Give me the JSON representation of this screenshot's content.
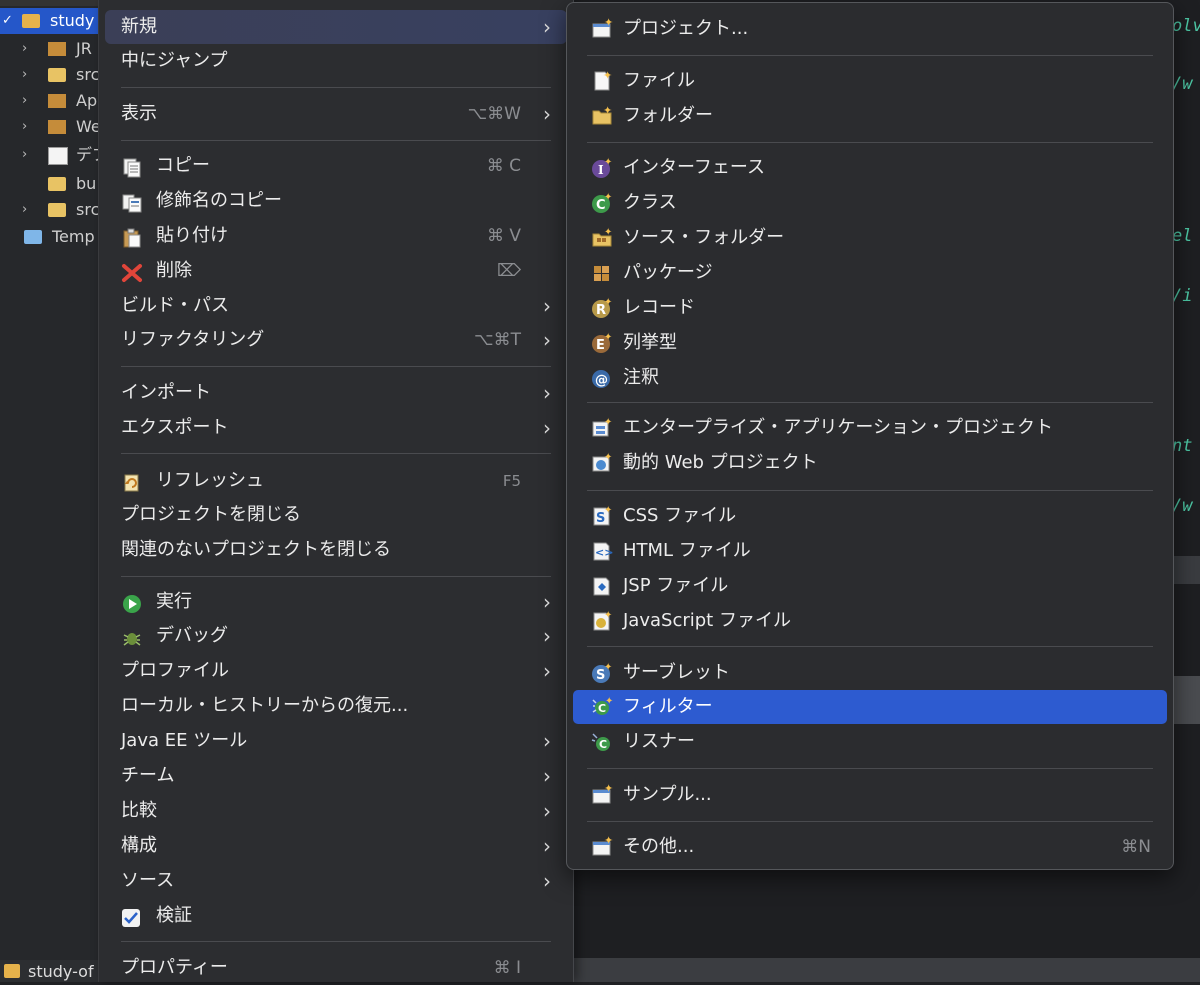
{
  "explorer": {
    "rows": [
      {
        "label": "study",
        "selected": true
      },
      {
        "label": "JR"
      },
      {
        "label": "src"
      },
      {
        "label": "Ap"
      },
      {
        "label": "We"
      },
      {
        "label": "デプ"
      },
      {
        "label": "bu"
      },
      {
        "label": "src"
      },
      {
        "label": "Temp"
      }
    ]
  },
  "editor": {
    "fragments": [
      "olv",
      "/w",
      "el",
      "/i",
      "nt",
      "/w"
    ]
  },
  "bottom_tab": {
    "label": "study-of"
  },
  "context_menu": {
    "items": [
      {
        "label": "新規",
        "arrow": "›",
        "highlighted": true
      },
      {
        "label": "中にジャンプ"
      },
      {
        "label": "表示",
        "shortcut": "⌥⌘W",
        "arrow": "›"
      },
      {
        "label": "コピー",
        "shortcut": "⌘ C",
        "icon": "copy-icon"
      },
      {
        "label": "修飾名のコピー",
        "icon": "copy-qualified-name-icon"
      },
      {
        "label": "貼り付け",
        "shortcut": "⌘ V",
        "icon": "paste-icon"
      },
      {
        "label": "削除",
        "shortcut": "⌦",
        "icon": "delete-icon"
      },
      {
        "label": "ビルド・パス",
        "arrow": "›"
      },
      {
        "label": "リファクタリング",
        "shortcut": "⌥⌘T",
        "arrow": "›"
      },
      {
        "label": "インポート",
        "arrow": "›"
      },
      {
        "label": "エクスポート",
        "arrow": "›"
      },
      {
        "label": "リフレッシュ",
        "shortcut": "F5",
        "icon": "refresh-icon"
      },
      {
        "label": "プロジェクトを閉じる"
      },
      {
        "label": "関連のないプロジェクトを閉じる"
      },
      {
        "label": "実行",
        "arrow": "›",
        "icon": "run-icon"
      },
      {
        "label": "デバッグ",
        "arrow": "›",
        "icon": "debug-icon"
      },
      {
        "label": "プロファイル",
        "arrow": "›"
      },
      {
        "label": "ローカル・ヒストリーからの復元..."
      },
      {
        "label": "Java EE ツール",
        "arrow": "›"
      },
      {
        "label": "チーム",
        "arrow": "›"
      },
      {
        "label": "比較",
        "arrow": "›"
      },
      {
        "label": "構成",
        "arrow": "›"
      },
      {
        "label": "ソース",
        "arrow": "›"
      },
      {
        "label": "検証",
        "icon": "checkbox-icon"
      },
      {
        "label": "プロパティー",
        "shortcut": "⌘ I"
      }
    ]
  },
  "submenu": {
    "items": [
      {
        "label": "プロジェクト...",
        "icon": "new-project-icon"
      },
      {
        "label": "ファイル",
        "icon": "new-file-icon"
      },
      {
        "label": "フォルダー",
        "icon": "new-folder-icon"
      },
      {
        "label": "インターフェース",
        "icon": "interface-icon"
      },
      {
        "label": "クラス",
        "icon": "class-icon"
      },
      {
        "label": "ソース・フォルダー",
        "icon": "source-folder-icon"
      },
      {
        "label": "パッケージ",
        "icon": "package-icon"
      },
      {
        "label": "レコード",
        "icon": "record-icon"
      },
      {
        "label": "列挙型",
        "icon": "enum-icon"
      },
      {
        "label": "注釈",
        "icon": "annotation-icon"
      },
      {
        "label": "エンタープライズ・アプリケーション・プロジェクト",
        "icon": "enterprise-app-icon"
      },
      {
        "label": "動的 Web プロジェクト",
        "icon": "dynamic-web-project-icon"
      },
      {
        "label": "CSS ファイル",
        "icon": "css-file-icon"
      },
      {
        "label": "HTML ファイル",
        "icon": "html-file-icon"
      },
      {
        "label": "JSP ファイル",
        "icon": "jsp-file-icon"
      },
      {
        "label": "JavaScript ファイル",
        "icon": "javascript-file-icon"
      },
      {
        "label": "サーブレット",
        "icon": "servlet-icon"
      },
      {
        "label": "フィルター",
        "icon": "filter-icon",
        "selected": true
      },
      {
        "label": "リスナー",
        "icon": "listener-icon"
      },
      {
        "label": "サンプル...",
        "icon": "sample-icon"
      },
      {
        "label": "その他...",
        "icon": "other-icon",
        "shortcut": "⌘N"
      }
    ]
  },
  "colors": {
    "selection": "#2d5bd0",
    "menu_bg": "#2c2d30",
    "code_text": "#4dc9a6"
  }
}
